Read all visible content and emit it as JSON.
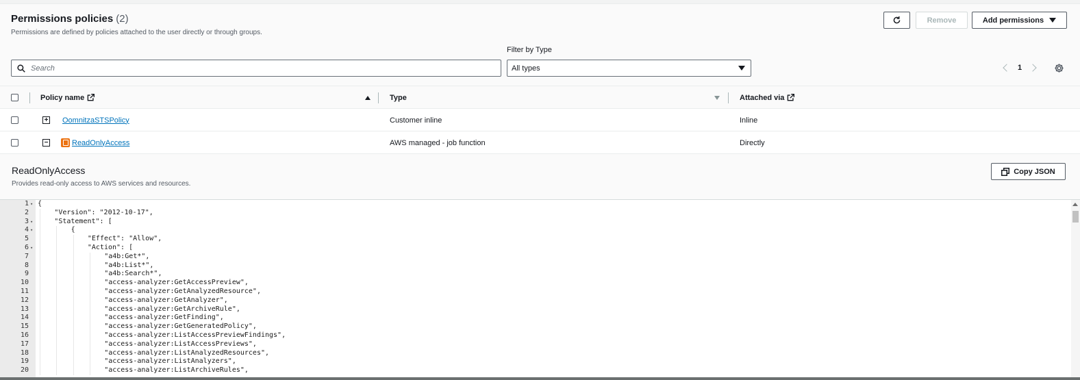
{
  "header": {
    "title": "Permissions policies",
    "count": "(2)",
    "description": "Permissions are defined by policies attached to the user directly or through groups."
  },
  "actions": {
    "remove_label": "Remove",
    "add_label": "Add permissions"
  },
  "filters": {
    "search_placeholder": "Search",
    "filter_label": "Filter by Type",
    "type_selected": "All types"
  },
  "pagination": {
    "page": "1"
  },
  "table": {
    "columns": {
      "policy_name": "Policy name",
      "type": "Type",
      "attached_via": "Attached via"
    },
    "rows": [
      {
        "name": "OomnitzaSTSPolicy",
        "type": "Customer inline",
        "attached": "Inline",
        "expander": "+"
      },
      {
        "name": "ReadOnlyAccess",
        "type": "AWS managed - job function",
        "attached": "Directly",
        "expander": "−"
      }
    ]
  },
  "detail": {
    "title": "ReadOnlyAccess",
    "description": "Provides read-only access to AWS services and resources.",
    "copy_label": "Copy JSON"
  },
  "code": {
    "lines": [
      {
        "n": "1",
        "fold": true,
        "indent": 0,
        "text": "{"
      },
      {
        "n": "2",
        "fold": false,
        "indent": 1,
        "text": "\"Version\": \"2012-10-17\","
      },
      {
        "n": "3",
        "fold": true,
        "indent": 1,
        "text": "\"Statement\": ["
      },
      {
        "n": "4",
        "fold": true,
        "indent": 2,
        "text": "{"
      },
      {
        "n": "5",
        "fold": false,
        "indent": 3,
        "text": "\"Effect\": \"Allow\","
      },
      {
        "n": "6",
        "fold": true,
        "indent": 3,
        "text": "\"Action\": ["
      },
      {
        "n": "7",
        "fold": false,
        "indent": 4,
        "text": "\"a4b:Get*\","
      },
      {
        "n": "8",
        "fold": false,
        "indent": 4,
        "text": "\"a4b:List*\","
      },
      {
        "n": "9",
        "fold": false,
        "indent": 4,
        "text": "\"a4b:Search*\","
      },
      {
        "n": "10",
        "fold": false,
        "indent": 4,
        "text": "\"access-analyzer:GetAccessPreview\","
      },
      {
        "n": "11",
        "fold": false,
        "indent": 4,
        "text": "\"access-analyzer:GetAnalyzedResource\","
      },
      {
        "n": "12",
        "fold": false,
        "indent": 4,
        "text": "\"access-analyzer:GetAnalyzer\","
      },
      {
        "n": "13",
        "fold": false,
        "indent": 4,
        "text": "\"access-analyzer:GetArchiveRule\","
      },
      {
        "n": "14",
        "fold": false,
        "indent": 4,
        "text": "\"access-analyzer:GetFinding\","
      },
      {
        "n": "15",
        "fold": false,
        "indent": 4,
        "text": "\"access-analyzer:GetGeneratedPolicy\","
      },
      {
        "n": "16",
        "fold": false,
        "indent": 4,
        "text": "\"access-analyzer:ListAccessPreviewFindings\","
      },
      {
        "n": "17",
        "fold": false,
        "indent": 4,
        "text": "\"access-analyzer:ListAccessPreviews\","
      },
      {
        "n": "18",
        "fold": false,
        "indent": 4,
        "text": "\"access-analyzer:ListAnalyzedResources\","
      },
      {
        "n": "19",
        "fold": false,
        "indent": 4,
        "text": "\"access-analyzer:ListAnalyzers\","
      },
      {
        "n": "20",
        "fold": false,
        "indent": 4,
        "text": "\"access-analyzer:ListArchiveRules\","
      }
    ]
  },
  "colors": {
    "link": "#0073bb",
    "aws_orange": "#ec7211",
    "text": "#16191f"
  },
  "icons": [
    "search-icon",
    "refresh-icon",
    "caret-down-icon",
    "gear-icon",
    "external-link-icon",
    "copy-icon",
    "aws-service-icon"
  ]
}
